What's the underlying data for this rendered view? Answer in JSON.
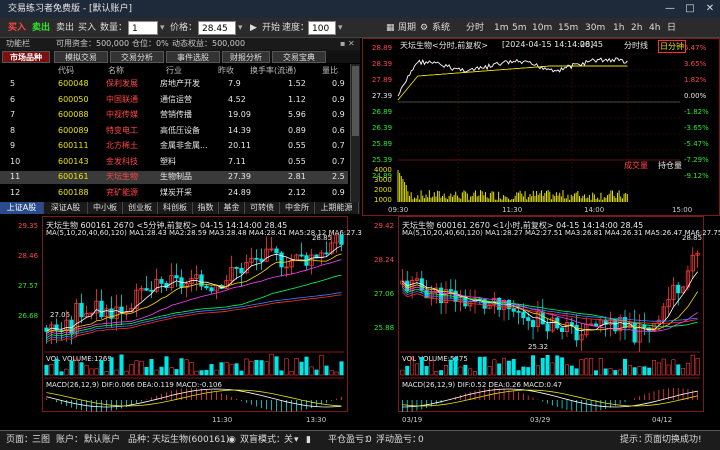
{
  "window": {
    "title": "交易练习者免费版 - [默认账户]"
  },
  "toolbar": {
    "buy_red": "买入",
    "sell_green": "卖出",
    "sell": "卖出",
    "buy": "买入",
    "qty_label": "数量：",
    "qty_value": "1",
    "price_label": "价格：",
    "price_value": "28.45",
    "play": "开始",
    "speed_label": "速度：",
    "speed_value": "100",
    "cycle": "周期",
    "system": "系统",
    "periods": [
      "分时",
      "1m",
      "5m",
      "10m",
      "15m",
      "30m",
      "1h",
      "2h",
      "4h",
      "日"
    ]
  },
  "info": {
    "func": "功能栏",
    "funds": "可用资金：500,000",
    "pos": "仓位：0%",
    "dyn": "动态权益：500,000"
  },
  "tabs": [
    "市场品种",
    "模拟交易",
    "交易分析",
    "事件选股",
    "财报分析",
    "交易宝典"
  ],
  "table": {
    "headers": [
      "代码",
      "名称",
      "行业",
      "昨收",
      "换手率(流通)",
      "量比"
    ],
    "rows": [
      {
        "n": "5",
        "code": "600048",
        "name": "保利发展",
        "ind": "房地产开发",
        "prev": "7.9",
        "turn": "1.52",
        "ratio": "0.9"
      },
      {
        "n": "6",
        "code": "600050",
        "name": "中国联通",
        "ind": "通信运营",
        "prev": "4.52",
        "turn": "1.12",
        "ratio": "0.9"
      },
      {
        "n": "7",
        "code": "600088",
        "name": "中视传媒",
        "ind": "营销传播",
        "prev": "19.09",
        "turn": "5.96",
        "ratio": "0.9"
      },
      {
        "n": "8",
        "code": "600089",
        "name": "特变电工",
        "ind": "高低压设备",
        "prev": "14.39",
        "turn": "0.89",
        "ratio": "0.6"
      },
      {
        "n": "9",
        "code": "600111",
        "name": "北方稀土",
        "ind": "金属非金属...",
        "prev": "20.11",
        "turn": "0.55",
        "ratio": "0.7"
      },
      {
        "n": "10",
        "code": "600143",
        "name": "金发科技",
        "ind": "塑料",
        "prev": "7.11",
        "turn": "0.55",
        "ratio": "0.7"
      },
      {
        "n": "11",
        "code": "600161",
        "name": "天坛生物",
        "ind": "生物制品",
        "prev": "27.39",
        "turn": "2.81",
        "ratio": "2.5"
      },
      {
        "n": "12",
        "code": "600188",
        "name": "兖矿能源",
        "ind": "煤炭开采",
        "prev": "24.89",
        "turn": "2.12",
        "ratio": "0.9"
      }
    ]
  },
  "boardtabs": [
    "上证A股",
    "深证A股",
    "中小板",
    "创业板",
    "科创板",
    "指数",
    "基金",
    "可转债",
    "中金所",
    "上期能源"
  ],
  "intraday": {
    "title": "天坛生物<分时,前复权>",
    "time": "[2024-04-15 14:14:00]",
    "price": "28.45",
    "mode1": "分时线",
    "mode2": "日分钟",
    "yl": [
      "28.89",
      "28.39",
      "27.89",
      "27.39",
      "26.89",
      "26.39",
      "25.89",
      "25.39",
      "24.89"
    ],
    "yr": [
      "5.47%",
      "3.65%",
      "1.82%",
      "0.00%",
      "-1.82%",
      "-3.65%",
      "-5.47%",
      "-7.29%",
      "-9.12%"
    ],
    "vol_label": "成交量",
    "pos_label": "持仓量",
    "vl": [
      "4000",
      "3000",
      "2000",
      "1000"
    ],
    "xt": [
      "09:30",
      "11:30",
      "14:00",
      "15:00"
    ]
  },
  "kl": {
    "title": "天坛生物 600161  2670  <5分钟,前复权> 04-15 14:14:00  28.45",
    "ma": "MA(5,10,20,40,60,120)  MA1:28.43 MA2:28.59 MA3:28.48 MA4:28.41 MA5:28.12 MA6:27.3",
    "yl": [
      "29.35",
      "28.46",
      "27.57",
      "26.68"
    ],
    "hi": "28.85",
    "lo": "27.05",
    "vol": "VOL  VOLUME:1269",
    "macd": "MACD(26,12,9)  DIF:0.066 DEA:0.119 MACD:-0.106",
    "xt": [
      "11:30",
      "13:30"
    ]
  },
  "kr": {
    "title": "天坛生物 600161  2670  <1小时,前复权> 04-15 14:14:00  28.45",
    "ma": "MA(5,10,20,40,60,120)  MA1:28.27 MA2:27.51 MA3:26.81 MA4:26.31 MA5:26.47 MA6:27.75",
    "yl": [
      "29.42",
      "28.24",
      "27.06",
      "25.88"
    ],
    "hi": "28.85",
    "lo": "25.32",
    "vol": "VOL  VOLUME:5875",
    "macd": "MACD(26,12,9)  DIF:0.52 DEA:0.26 MACD:0.47",
    "xt": [
      "03/19",
      "03/29",
      "04/12"
    ]
  },
  "status": {
    "page": "页面：",
    "view": "三图",
    "acct_label": "账户：",
    "acct": "默认账户",
    "sym_label": "品种：",
    "sym": "天坛生物(600161)",
    "mode": "双盲模式：",
    "mode_val": "关",
    "pl": "平仓盈亏：",
    "pl_val": "0",
    "fl": "浮动盈亏：",
    "fl_val": "0",
    "tip": "提示：",
    "tip_val": "页面切换成功!"
  },
  "colors": {
    "up": "#ff3b3b",
    "down": "#00e5e5",
    "ma1": "#ffffff",
    "ma2": "#ffd700",
    "ma3": "#ff40ff",
    "ma4": "#00ff66",
    "ma5": "#4080ff",
    "ma6": "#ff3030",
    "frame": "#7a1a1a"
  }
}
